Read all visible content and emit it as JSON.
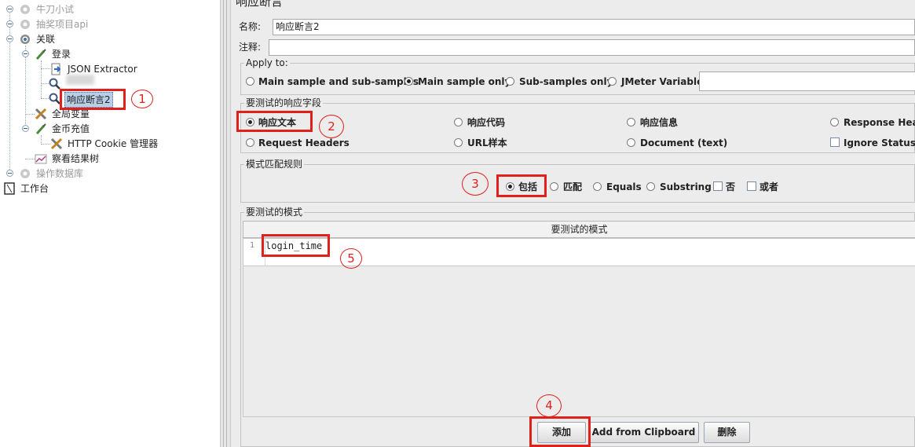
{
  "tree": {
    "items": [
      {
        "label": "牛刀小试"
      },
      {
        "label": "抽奖项目api"
      },
      {
        "label": "关联"
      },
      {
        "label": "登录"
      },
      {
        "label": "JSON Extractor"
      },
      {
        "label": "响应断言2"
      },
      {
        "label": "全局变量"
      },
      {
        "label": "金币充值"
      },
      {
        "label": "HTTP Cookie 管理器"
      },
      {
        "label": "察看结果树"
      },
      {
        "label": "操作数据库"
      },
      {
        "label": "工作台"
      }
    ]
  },
  "panel": {
    "title": "响应断言",
    "name_label": "名称:",
    "name_value": "响应断言2",
    "comment_label": "注释:",
    "comment_value": ""
  },
  "apply_to": {
    "title": "Apply to:",
    "options": [
      "Main sample and sub-samples",
      "Main sample only",
      "Sub-samples only",
      "JMeter Variable"
    ],
    "selected": "Main sample only",
    "jmeter_variable_value": ""
  },
  "response_field": {
    "title": "要测试的响应字段",
    "options": [
      "响应文本",
      "响应代码",
      "响应信息",
      "Response Headers",
      "Request Headers",
      "URL样本",
      "Document (text)"
    ],
    "selected": "响应文本",
    "ignore_status_label": "Ignore Status",
    "ignore_status_checked": false
  },
  "match_rules": {
    "title": "模式匹配规则",
    "options": [
      "包括",
      "匹配",
      "Equals",
      "Substring"
    ],
    "selected": "包括",
    "not_label": "否",
    "or_label": "或者"
  },
  "patterns": {
    "title": "要测试的模式",
    "column_header": "要测试的模式",
    "rows": [
      {
        "line": "1",
        "value": "login_time"
      }
    ]
  },
  "buttons": {
    "add": "添加",
    "add_from_clipboard": "Add from Clipboard",
    "delete": "删除"
  },
  "annotations": [
    "1",
    "2",
    "3",
    "4",
    "5"
  ],
  "colors": {
    "annotation_red": "#e0201a",
    "selection_bg": "#b8cfe8",
    "panel_bg": "#ececec"
  }
}
